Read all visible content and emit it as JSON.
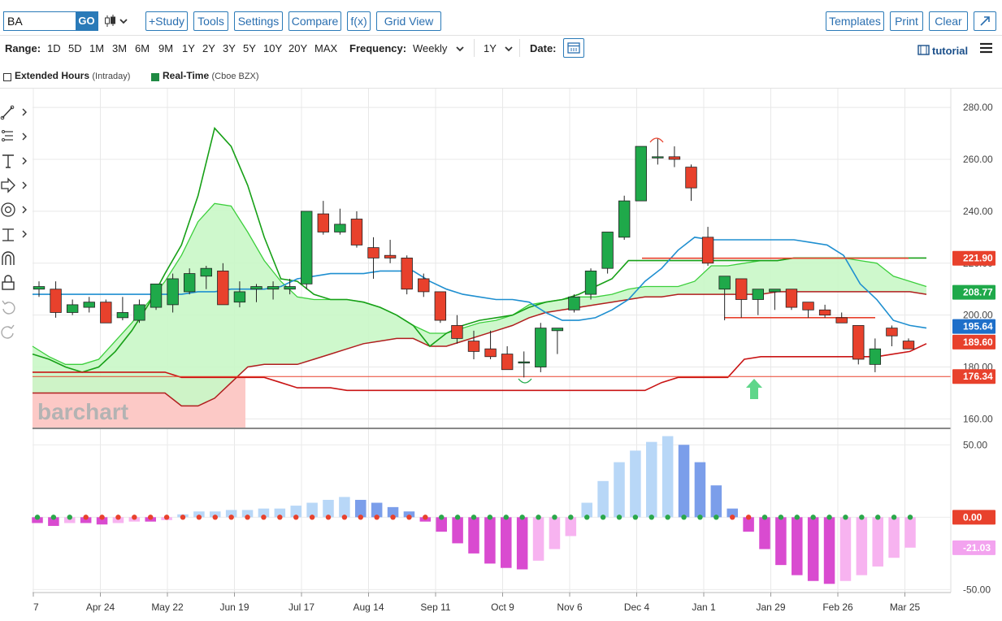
{
  "toolbar": {
    "symbol": "BA",
    "go_label": "GO",
    "study_label": "+Study",
    "tools_label": "Tools",
    "settings_label": "Settings",
    "compare_label": "Compare",
    "fx_label": "f(x)",
    "gridview_label": "Grid View",
    "templates_label": "Templates",
    "print_label": "Print",
    "clear_label": "Clear",
    "expand_icon": "expand-arrow-icon"
  },
  "range_bar": {
    "range_label": "Range:",
    "ranges": [
      "1D",
      "5D",
      "1M",
      "3M",
      "6M",
      "9M",
      "1Y",
      "2Y",
      "3Y",
      "5Y",
      "10Y",
      "20Y",
      "MAX"
    ],
    "frequency_label": "Frequency:",
    "frequency_value": "Weekly",
    "period_value": "1Y",
    "date_label": "Date:",
    "tutorial_label": "tutorial"
  },
  "options_bar": {
    "extended_hours_label": "Extended Hours",
    "extended_hours_note": "(Intraday)",
    "realtime_label": "Real-Time",
    "realtime_note": "(Cboe BZX)"
  },
  "colors": {
    "up": "#1fa94a",
    "down": "#e8412c",
    "cloud": "#c9f7c6",
    "accent": "#2a7ab8",
    "macd_pos_dark": "#7b9eea",
    "macd_pos_light": "#b8d7f7",
    "macd_neg_dark": "#d94bd0",
    "macd_neg_light": "#f7b3f0"
  },
  "chart_data": {
    "type": "candlestick",
    "watermark": "barchart",
    "price_axis": {
      "ticks": [
        "280.00",
        "260.00",
        "240.00",
        "220.00",
        "200.00",
        "180.00",
        "160.00"
      ],
      "range": [
        157,
        286
      ]
    },
    "price_tags": [
      {
        "label": "221.90",
        "value": 221.9,
        "color": "#e8412c"
      },
      {
        "label": "208.77",
        "value": 208.77,
        "color": "#1fa94a"
      },
      {
        "label": "195.64",
        "value": 195.64,
        "color": "#1e6fc9"
      },
      {
        "label": "189.60",
        "value": 189.6,
        "color": "#e8412c"
      },
      {
        "label": "176.34",
        "value": 176.34,
        "color": "#e8412c"
      }
    ],
    "x_labels": [
      "7",
      "Apr 24",
      "May 22",
      "Jun 19",
      "Jul 17",
      "Aug 14",
      "Sep 11",
      "Oct 9",
      "Nov 6",
      "Dec 4",
      "Jan 1",
      "Jan 29",
      "Feb 26",
      "Mar 25"
    ],
    "candles": [
      [
        210,
        213,
        207,
        211
      ],
      [
        210,
        213,
        199,
        201
      ],
      [
        201,
        206,
        200,
        204
      ],
      [
        203,
        207,
        201,
        205
      ],
      [
        205,
        206,
        197,
        197
      ],
      [
        199,
        207,
        198,
        201
      ],
      [
        198,
        206,
        197,
        204
      ],
      [
        203,
        209,
        202,
        212
      ],
      [
        204,
        216,
        201,
        214
      ],
      [
        209,
        218,
        208,
        216
      ],
      [
        215,
        219,
        210,
        218
      ],
      [
        217,
        220,
        206,
        204
      ],
      [
        205,
        213,
        203,
        209
      ],
      [
        210,
        212,
        205,
        211
      ],
      [
        210,
        213,
        206,
        211
      ],
      [
        210,
        214,
        208,
        211
      ],
      [
        212,
        240,
        210,
        240
      ],
      [
        239,
        244,
        231,
        232
      ],
      [
        232,
        241,
        231,
        235
      ],
      [
        237,
        240,
        226,
        227
      ],
      [
        226,
        230,
        214,
        222
      ],
      [
        223,
        229,
        220,
        222
      ],
      [
        222,
        223,
        208,
        210
      ],
      [
        214,
        216,
        207,
        209
      ],
      [
        209,
        208,
        197,
        198
      ],
      [
        196,
        200,
        189,
        191
      ],
      [
        190,
        194,
        183,
        186
      ],
      [
        187,
        194,
        183,
        184
      ],
      [
        185,
        188,
        180,
        179
      ],
      [
        182,
        186,
        176,
        182
      ],
      [
        180,
        197,
        178,
        195
      ],
      [
        194,
        195,
        185,
        195
      ],
      [
        202,
        208,
        201,
        207
      ],
      [
        208,
        218,
        206,
        217
      ],
      [
        218,
        232,
        216,
        232
      ],
      [
        230,
        246,
        229,
        244
      ],
      [
        244,
        265,
        244,
        265
      ],
      [
        261,
        268,
        258,
        261
      ],
      [
        261,
        265,
        257,
        260
      ],
      [
        257,
        258,
        244,
        249
      ],
      [
        230,
        234,
        219,
        220
      ],
      [
        210,
        215,
        198,
        215
      ],
      [
        214,
        214,
        199,
        206
      ],
      [
        206,
        210,
        200,
        210
      ],
      [
        209,
        210,
        202,
        210
      ],
      [
        210,
        209,
        202,
        203
      ],
      [
        205,
        203,
        199,
        202
      ],
      [
        202,
        204,
        199,
        200
      ],
      [
        199,
        201,
        197,
        197
      ],
      [
        196,
        196,
        181,
        183
      ],
      [
        181,
        191,
        178,
        187
      ],
      [
        195,
        196,
        188,
        192
      ],
      [
        190,
        191,
        188,
        187
      ]
    ],
    "indicator_lines": {
      "cloud_upper": [
        188,
        184,
        181,
        181,
        183,
        190,
        197,
        205,
        213,
        223,
        236,
        243,
        242,
        232,
        221,
        213,
        207,
        206,
        206,
        206,
        205,
        203,
        200,
        196,
        193,
        193,
        195,
        197,
        198,
        200,
        204,
        205,
        206,
        207,
        207,
        208,
        210,
        211,
        211,
        211,
        213,
        219,
        219,
        220,
        221,
        221,
        222,
        222,
        222,
        222,
        221,
        220,
        215,
        213,
        211
      ],
      "cloud_lower": [
        170,
        170,
        170,
        170,
        170,
        170,
        170,
        170,
        170,
        165,
        165,
        168,
        174,
        180,
        181,
        181,
        181,
        183,
        185,
        187,
        189,
        190,
        191,
        191,
        188,
        188,
        190,
        192,
        194,
        196,
        199,
        201,
        202,
        203,
        204,
        205,
        206,
        207,
        207,
        208,
        208,
        208,
        208,
        208,
        208,
        209,
        209,
        209,
        209,
        209,
        209,
        209,
        209,
        209,
        208
      ],
      "conversion_line": [
        185,
        183,
        180,
        178,
        180,
        186,
        194,
        204,
        216,
        227,
        246,
        272,
        265,
        250,
        230,
        214,
        213,
        208,
        206,
        206,
        205,
        203,
        200,
        196,
        188,
        193,
        196,
        198,
        199,
        200,
        203,
        205,
        206,
        208,
        211,
        214,
        221,
        221,
        221,
        221,
        221,
        221,
        221,
        221,
        221,
        221,
        222,
        222,
        222,
        222,
        222,
        222,
        222,
        222,
        222
      ],
      "blue_line": [
        208,
        208,
        208,
        208,
        208,
        208,
        208,
        208,
        208,
        208,
        209,
        209,
        210,
        210,
        210,
        211,
        214,
        215,
        216,
        216,
        216,
        217,
        217,
        217,
        213,
        210,
        208,
        207,
        206,
        206,
        205,
        201,
        198,
        198,
        199,
        202,
        206,
        213,
        218,
        225,
        230,
        229,
        229,
        229,
        229,
        229,
        229,
        228,
        227,
        223,
        212,
        206,
        198,
        196,
        195
      ],
      "red_base": [
        178,
        178,
        178,
        178,
        178,
        178,
        178,
        178,
        178,
        176,
        176,
        176,
        176,
        176,
        176,
        174,
        172,
        172,
        172,
        171,
        171,
        171,
        171,
        171,
        171,
        171,
        171,
        171,
        171,
        171,
        171,
        171,
        171,
        171,
        171,
        171,
        171,
        171,
        174,
        176,
        176,
        176,
        176,
        183,
        184,
        184,
        184,
        184,
        184,
        184,
        184,
        184,
        185,
        186,
        189
      ]
    },
    "horizontal_lines": [
      {
        "value": 176.34,
        "color": "#e8412c"
      },
      {
        "value": 221.9,
        "color": "#e8412c"
      },
      {
        "value": 199,
        "color": "#e8412c"
      }
    ],
    "macd_axis": {
      "ticks": [
        "50.00",
        "0.00",
        "-50.00"
      ],
      "range": [
        -52,
        58
      ]
    },
    "macd_tags": [
      {
        "label": "0.00",
        "value": 0,
        "color": "#e8412c"
      },
      {
        "label": "-21.03",
        "value": -21.03,
        "color": "#f3a3ef"
      }
    ],
    "macd_histogram": [
      -4,
      -6,
      -4,
      -4,
      -5,
      -4,
      -3,
      -3,
      -2,
      2,
      4,
      4,
      5,
      5,
      6,
      6,
      8,
      10,
      12,
      14,
      12,
      10,
      7,
      4,
      -3,
      -10,
      -18,
      -25,
      -32,
      -35,
      -36,
      -30,
      -22,
      -13,
      10,
      25,
      38,
      46,
      52,
      56,
      50,
      38,
      22,
      6,
      -10,
      -22,
      -33,
      -40,
      -44,
      -46,
      -44,
      -40,
      -34,
      -28,
      -21
    ]
  }
}
